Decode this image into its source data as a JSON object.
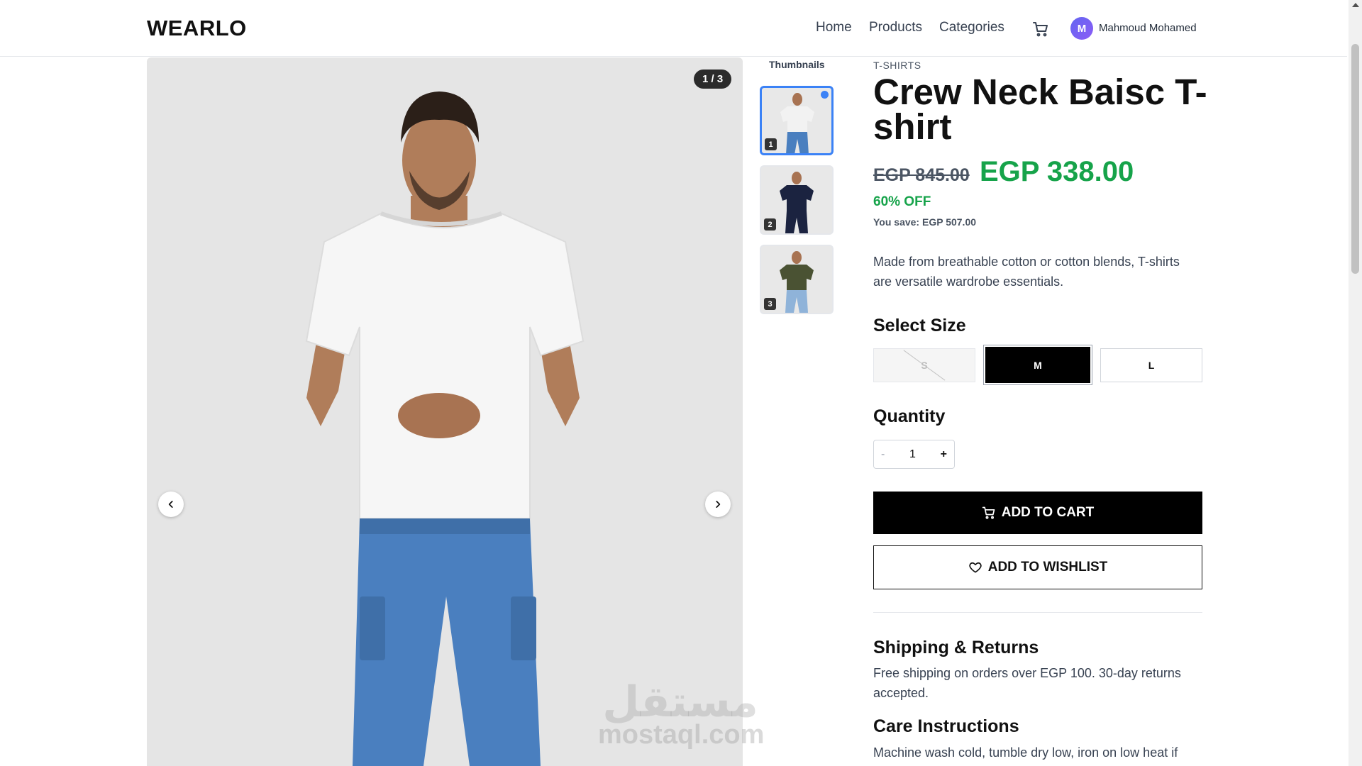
{
  "header": {
    "logo": "WEARLO",
    "nav": {
      "home": "Home",
      "products": "Products",
      "categories": "Categories"
    },
    "user": {
      "initial": "M",
      "name": "Mahmoud Mohamed"
    }
  },
  "gallery": {
    "counter": "1 / 3",
    "thumbnails_title": "Thumbnails",
    "thumbnails": [
      {
        "number": "1",
        "shirt_color": "#f2f2f2",
        "pants_color": "#4a7fbf"
      },
      {
        "number": "2",
        "shirt_color": "#1b2340",
        "pants_color": "#1b2340"
      },
      {
        "number": "3",
        "shirt_color": "#4a5233",
        "pants_color": "#8fb3d9"
      }
    ]
  },
  "product": {
    "category": "T-SHIRTS",
    "title": "Crew Neck Baisc T-shirt",
    "old_price": "EGP 845.00",
    "new_price": "EGP 338.00",
    "discount": "60% OFF",
    "savings": "You save: EGP 507.00",
    "description": "Made from breathable cotton or cotton blends, T-shirts are versatile wardrobe essentials.",
    "size_label": "Select Size",
    "sizes": [
      "S",
      "M",
      "L"
    ],
    "selected_size": "M",
    "quantity_label": "Quantity",
    "quantity": {
      "minus": "-",
      "value": "1",
      "plus": "+"
    },
    "add_to_cart": "ADD TO CART",
    "add_to_wishlist": "ADD TO WISHLIST",
    "shipping_title": "Shipping & Returns",
    "shipping_text": "Free shipping on orders over EGP 100. 30-day returns accepted.",
    "care_title": "Care Instructions",
    "care_text": "Machine wash cold, tumble dry low, iron on low heat if"
  },
  "watermark": {
    "latin": "mostaql.com",
    "arabic": "مستقل"
  },
  "colors": {
    "accent": "#3b82f6",
    "price_green": "#16a34a",
    "primary": "#000000"
  }
}
